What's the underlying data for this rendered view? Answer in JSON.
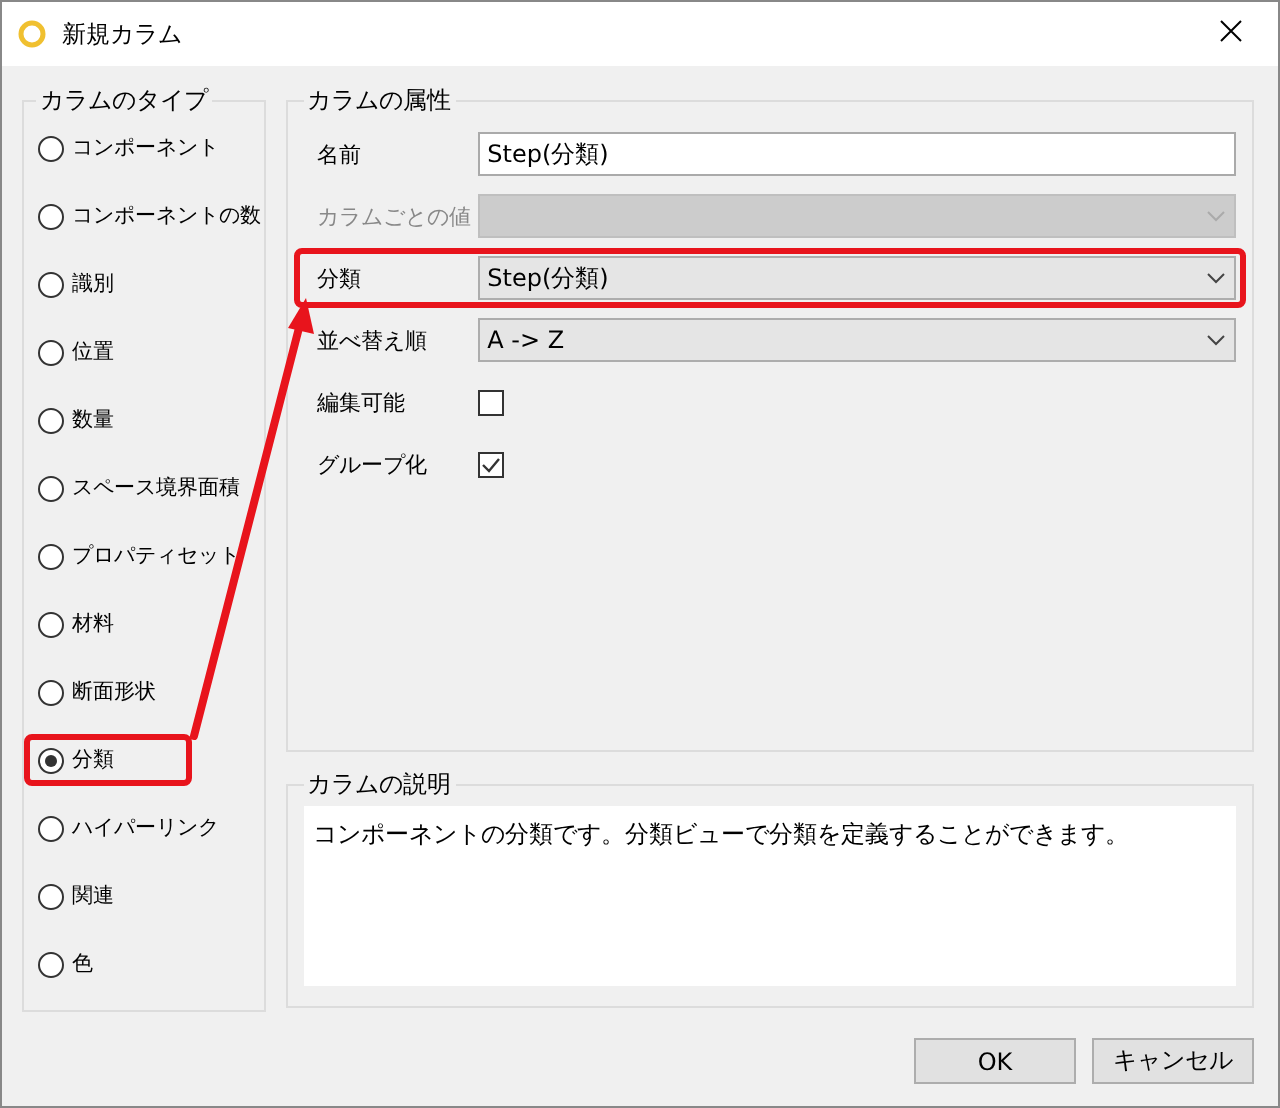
{
  "window": {
    "title": "新規カラム"
  },
  "column_type": {
    "title": "カラムのタイプ",
    "options": [
      {
        "label": "コンポーネント",
        "selected": false,
        "highlighted": false
      },
      {
        "label": "コンポーネントの数",
        "selected": false,
        "highlighted": false
      },
      {
        "label": "識別",
        "selected": false,
        "highlighted": false
      },
      {
        "label": "位置",
        "selected": false,
        "highlighted": false
      },
      {
        "label": "数量",
        "selected": false,
        "highlighted": false
      },
      {
        "label": "スペース境界面積",
        "selected": false,
        "highlighted": false
      },
      {
        "label": "プロパティセット",
        "selected": false,
        "highlighted": false
      },
      {
        "label": "材料",
        "selected": false,
        "highlighted": false
      },
      {
        "label": "断面形状",
        "selected": false,
        "highlighted": false
      },
      {
        "label": "分類",
        "selected": true,
        "highlighted": true
      },
      {
        "label": "ハイパーリンク",
        "selected": false,
        "highlighted": false
      },
      {
        "label": "関連",
        "selected": false,
        "highlighted": false
      },
      {
        "label": "色",
        "selected": false,
        "highlighted": false
      }
    ]
  },
  "attributes": {
    "title": "カラムの属性",
    "rows": [
      {
        "kind": "text",
        "label": "名前",
        "value": "Step(分類)",
        "disabled": false,
        "highlighted": false
      },
      {
        "kind": "combo",
        "label": "カラムごとの値",
        "disabled": true,
        "highlighted": false
      },
      {
        "kind": "combo",
        "label": "分類",
        "value": "Step(分類)",
        "disabled": false,
        "highlighted": true
      },
      {
        "kind": "combo",
        "label": "並べ替え順",
        "value": "A -> Z",
        "disabled": false,
        "highlighted": false
      },
      {
        "kind": "checkbox",
        "label": "編集可能",
        "checked": false
      },
      {
        "kind": "checkbox",
        "label": "グループ化",
        "checked": true
      }
    ]
  },
  "description": {
    "title": "カラムの説明",
    "text": "コンポーネントの分類です。分類ビューで分類を定義することができます。"
  },
  "annotations": [
    {
      "kind": "arrow"
    }
  ],
  "buttons": [
    "OK",
    "キャンセル"
  ]
}
